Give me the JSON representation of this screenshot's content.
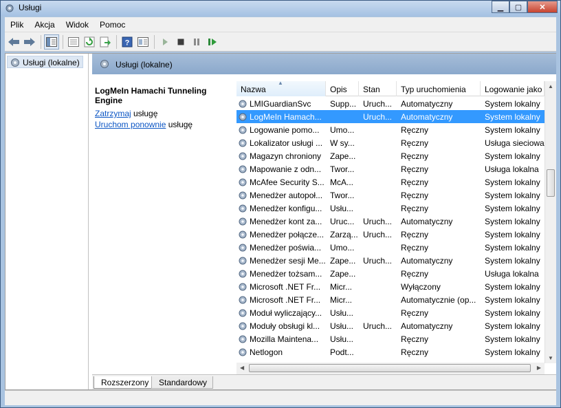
{
  "window": {
    "title": "Usługi"
  },
  "menu": [
    "Plik",
    "Akcja",
    "Widok",
    "Pomoc"
  ],
  "toolbar": {
    "buttons": [
      "back-arrow-icon",
      "forward-arrow-icon",
      "show-console-tree-icon",
      "properties-icon",
      "refresh-icon",
      "export-list-icon",
      "help-icon",
      "view-icon",
      "start-service-icon",
      "stop-service-icon",
      "pause-service-icon",
      "restart-service-icon"
    ]
  },
  "tree": {
    "root_label": "Usługi (lokalne)"
  },
  "panel_header": {
    "label": "Usługi (lokalne)"
  },
  "description": {
    "service_title": "LogMeIn Hamachi Tunneling Engine",
    "stop_link": "Zatrzymaj",
    "stop_suffix": " usługę",
    "restart_link": "Uruchom ponownie",
    "restart_suffix": " usługę"
  },
  "columns": [
    "Nazwa",
    "Opis",
    "Stan",
    "Typ uruchomienia",
    "Logowanie jako"
  ],
  "rows": [
    [
      "LMIGuardianSvc",
      "Supp...",
      "Uruch...",
      "Automatyczny",
      "System lokalny"
    ],
    [
      "LogMeIn Hamach...",
      "",
      "Uruch...",
      "Automatyczny",
      "System lokalny"
    ],
    [
      "Logowanie pomo...",
      "Umo...",
      "",
      "Ręczny",
      "System lokalny"
    ],
    [
      "Lokalizator usługi ...",
      "W sy...",
      "",
      "Ręczny",
      "Usługa sieciowa"
    ],
    [
      "Magazyn chroniony",
      "Zape...",
      "",
      "Ręczny",
      "System lokalny"
    ],
    [
      "Mapowanie z odn...",
      "Twor...",
      "",
      "Ręczny",
      "Usługa lokalna"
    ],
    [
      "McAfee Security S...",
      "McA...",
      "",
      "Ręczny",
      "System lokalny"
    ],
    [
      "Menedżer autopoł...",
      "Twor...",
      "",
      "Ręczny",
      "System lokalny"
    ],
    [
      "Menedżer konfigu...",
      "Usłu...",
      "",
      "Ręczny",
      "System lokalny"
    ],
    [
      "Menedżer kont za...",
      "Uruc...",
      "Uruch...",
      "Automatyczny",
      "System lokalny"
    ],
    [
      "Menedżer połącze...",
      "Zarzą...",
      "Uruch...",
      "Ręczny",
      "System lokalny"
    ],
    [
      "Menedżer poświa...",
      "Umo...",
      "",
      "Ręczny",
      "System lokalny"
    ],
    [
      "Menedżer sesji Me...",
      "Zape...",
      "Uruch...",
      "Automatyczny",
      "System lokalny"
    ],
    [
      "Menedżer tożsam...",
      "Zape...",
      "",
      "Ręczny",
      "Usługa lokalna"
    ],
    [
      "Microsoft .NET Fr...",
      "Micr...",
      "",
      "Wyłączony",
      "System lokalny"
    ],
    [
      "Microsoft .NET Fr...",
      "Micr...",
      "",
      "Automatycznie (op...",
      "System lokalny"
    ],
    [
      "Moduł wyliczający...",
      "Usłu...",
      "",
      "Ręczny",
      "System lokalny"
    ],
    [
      "Moduły obsługi kl...",
      "Usłu...",
      "Uruch...",
      "Automatyczny",
      "System lokalny"
    ],
    [
      "Mozilla Maintena...",
      "Usłu...",
      "",
      "Ręczny",
      "System lokalny"
    ],
    [
      "Netlogon",
      "Podt...",
      "",
      "Ręczny",
      "System lokalny"
    ]
  ],
  "selected_row": 1,
  "tabs": [
    "Rozszerzony",
    "Standardowy"
  ],
  "colors": {
    "selection": "#3399ff",
    "link": "#0b55c4",
    "header_band": "#8ba9cc"
  }
}
